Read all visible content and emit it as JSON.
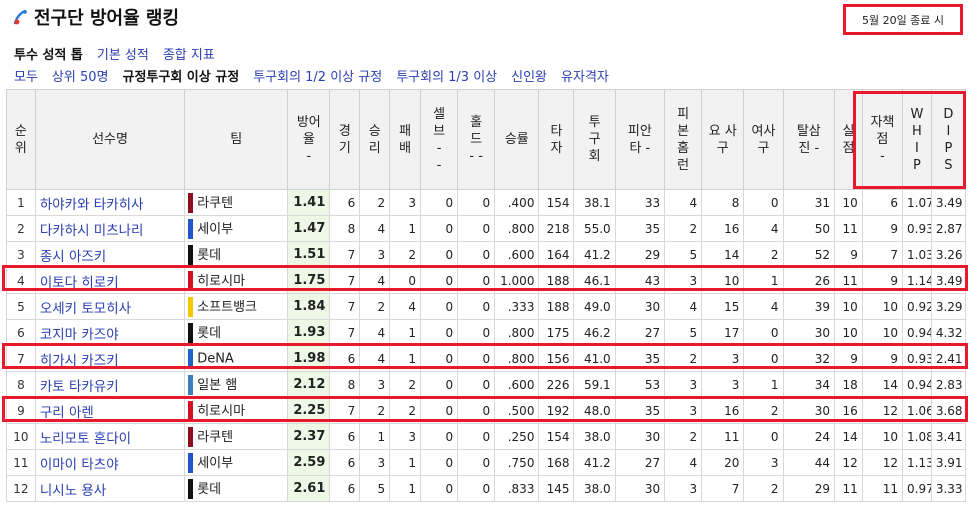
{
  "header": {
    "title": "전구단 방어율 랭킹",
    "update_time": "5월 20일 종료 시"
  },
  "nav": {
    "row1": [
      {
        "label": "투수 성적 톱",
        "active": true
      },
      {
        "label": "기본 성적",
        "active": false
      },
      {
        "label": "종합 지표",
        "active": false
      }
    ],
    "row2": [
      {
        "label": "모두",
        "active": false
      },
      {
        "label": "상위 50명",
        "active": false
      },
      {
        "label": "규정투구회 이상 규정",
        "active": true
      },
      {
        "label": "투구회의 1/2 이상 규정",
        "active": false
      },
      {
        "label": "투구회의 1/3 이상",
        "active": false
      },
      {
        "label": "신인왕",
        "active": false
      },
      {
        "label": "유자격자",
        "active": false
      }
    ]
  },
  "table": {
    "headers": [
      "순\n위",
      "선수명",
      "팀",
      "방어\n율\n-",
      "경\n기",
      "승\n리",
      "패\n배",
      "셀\n브\n-\n-",
      "홀\n드\n- -",
      "승률",
      "타\n자",
      "투\n구\n회",
      "피안\n타 -",
      "피\n본\n홈\n런",
      "요 사\n구",
      "여사\n구",
      "탈삼\n진 -",
      "실\n점",
      "자책\n점\n-",
      "W\nH\nI\nP",
      "D\nI\nP\nS"
    ],
    "team_colors": {
      "라쿠텐": "#8b0f1f",
      "세이부": "#2156c9",
      "롯데": "#111111",
      "히로시마": "#d21122",
      "소프트뱅크": "#f6c800",
      "DeNA": "#1e63c8",
      "일본 햄": "#3b7fbf"
    },
    "rows": [
      {
        "rank": "1",
        "name": "하야카와 타카히사",
        "team": "라쿠텐",
        "era": "1.41",
        "g": "6",
        "w": "2",
        "l": "3",
        "sv": "0",
        "hld": "0",
        "pct": ".400",
        "bf": "154",
        "ip": "38.1",
        "h": "33",
        "hr": "4",
        "bb": "8",
        "hbp": "0",
        "so": "31",
        "r": "10",
        "er": "6",
        "whip": "1.07",
        "dips": "3.49"
      },
      {
        "rank": "2",
        "name": "다카하시 미츠나리",
        "team": "세이부",
        "era": "1.47",
        "g": "8",
        "w": "4",
        "l": "1",
        "sv": "0",
        "hld": "0",
        "pct": ".800",
        "bf": "218",
        "ip": "55.0",
        "h": "35",
        "hr": "2",
        "bb": "16",
        "hbp": "4",
        "so": "50",
        "r": "11",
        "er": "9",
        "whip": "0.93",
        "dips": "2.87"
      },
      {
        "rank": "3",
        "name": "종시 아즈키",
        "team": "롯데",
        "era": "1.51",
        "g": "7",
        "w": "3",
        "l": "2",
        "sv": "0",
        "hld": "0",
        "pct": ".600",
        "bf": "164",
        "ip": "41.2",
        "h": "29",
        "hr": "5",
        "bb": "14",
        "hbp": "2",
        "so": "52",
        "r": "9",
        "er": "7",
        "whip": "1.03",
        "dips": "3.26"
      },
      {
        "rank": "4",
        "name": "이토다 히로키",
        "team": "히로시마",
        "era": "1.75",
        "g": "7",
        "w": "4",
        "l": "0",
        "sv": "0",
        "hld": "0",
        "pct": "1.000",
        "bf": "188",
        "ip": "46.1",
        "h": "43",
        "hr": "3",
        "bb": "10",
        "hbp": "1",
        "so": "26",
        "r": "11",
        "er": "9",
        "whip": "1.14",
        "dips": "3.49"
      },
      {
        "rank": "5",
        "name": "오세키 토모히사",
        "team": "소프트뱅크",
        "era": "1.84",
        "g": "7",
        "w": "2",
        "l": "4",
        "sv": "0",
        "hld": "0",
        "pct": ".333",
        "bf": "188",
        "ip": "49.0",
        "h": "30",
        "hr": "4",
        "bb": "15",
        "hbp": "4",
        "so": "39",
        "r": "10",
        "er": "10",
        "whip": "0.92",
        "dips": "3.29"
      },
      {
        "rank": "6",
        "name": "코지마 카즈야",
        "team": "롯데",
        "era": "1.93",
        "g": "7",
        "w": "4",
        "l": "1",
        "sv": "0",
        "hld": "0",
        "pct": ".800",
        "bf": "175",
        "ip": "46.2",
        "h": "27",
        "hr": "5",
        "bb": "17",
        "hbp": "0",
        "so": "30",
        "r": "10",
        "er": "10",
        "whip": "0.94",
        "dips": "4.32"
      },
      {
        "rank": "7",
        "name": "히가시 카즈키",
        "team": "DeNA",
        "era": "1.98",
        "g": "6",
        "w": "4",
        "l": "1",
        "sv": "0",
        "hld": "0",
        "pct": ".800",
        "bf": "156",
        "ip": "41.0",
        "h": "35",
        "hr": "2",
        "bb": "3",
        "hbp": "0",
        "so": "32",
        "r": "9",
        "er": "9",
        "whip": "0.93",
        "dips": "2.41"
      },
      {
        "rank": "8",
        "name": "카토 타카유키",
        "team": "일본 햄",
        "era": "2.12",
        "g": "8",
        "w": "3",
        "l": "2",
        "sv": "0",
        "hld": "0",
        "pct": ".600",
        "bf": "226",
        "ip": "59.1",
        "h": "53",
        "hr": "3",
        "bb": "3",
        "hbp": "1",
        "so": "34",
        "r": "18",
        "er": "14",
        "whip": "0.94",
        "dips": "2.83"
      },
      {
        "rank": "9",
        "name": "구리 아렌",
        "team": "히로시마",
        "era": "2.25",
        "g": "7",
        "w": "2",
        "l": "2",
        "sv": "0",
        "hld": "0",
        "pct": ".500",
        "bf": "192",
        "ip": "48.0",
        "h": "35",
        "hr": "3",
        "bb": "16",
        "hbp": "2",
        "so": "30",
        "r": "16",
        "er": "12",
        "whip": "1.06",
        "dips": "3.68"
      },
      {
        "rank": "10",
        "name": "노리모토 혼다이",
        "team": "라쿠텐",
        "era": "2.37",
        "g": "6",
        "w": "1",
        "l": "3",
        "sv": "0",
        "hld": "0",
        "pct": ".250",
        "bf": "154",
        "ip": "38.0",
        "h": "30",
        "hr": "2",
        "bb": "11",
        "hbp": "0",
        "so": "24",
        "r": "14",
        "er": "10",
        "whip": "1.08",
        "dips": "3.41"
      },
      {
        "rank": "11",
        "name": "이마이 타츠야",
        "team": "세이부",
        "era": "2.59",
        "g": "6",
        "w": "3",
        "l": "1",
        "sv": "0",
        "hld": "0",
        "pct": ".750",
        "bf": "168",
        "ip": "41.2",
        "h": "27",
        "hr": "4",
        "bb": "20",
        "hbp": "3",
        "so": "44",
        "r": "12",
        "er": "12",
        "whip": "1.13",
        "dips": "3.91"
      },
      {
        "rank": "12",
        "name": "니시노 용사",
        "team": "롯데",
        "era": "2.61",
        "g": "6",
        "w": "5",
        "l": "1",
        "sv": "0",
        "hld": "0",
        "pct": ".833",
        "bf": "145",
        "ip": "38.0",
        "h": "30",
        "hr": "3",
        "bb": "7",
        "hbp": "2",
        "so": "29",
        "r": "11",
        "er": "11",
        "whip": "0.97",
        "dips": "3.33"
      }
    ]
  }
}
